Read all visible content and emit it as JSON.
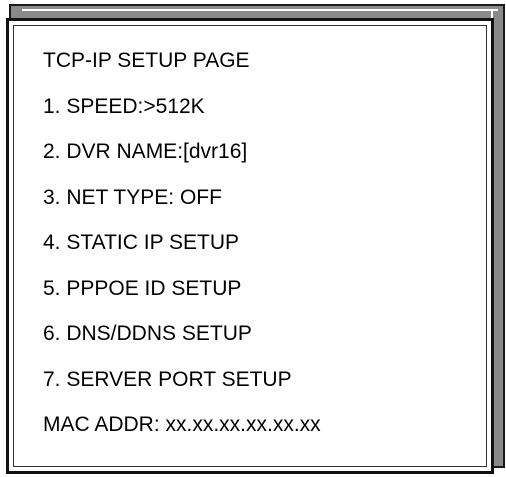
{
  "menu": {
    "title": "TCP-IP SETUP PAGE",
    "items": [
      {
        "label": "1. SPEED:>512K"
      },
      {
        "label": "2. DVR NAME:[dvr16]"
      },
      {
        "label": "3. NET TYPE: OFF"
      },
      {
        "label": "4. STATIC IP SETUP"
      },
      {
        "label": "5. PPPOE ID SETUP"
      },
      {
        "label": "6. DNS/DDNS SETUP"
      },
      {
        "label": "7. SERVER PORT SETUP"
      }
    ],
    "mac_address": "MAC ADDR: xx.xx.xx.xx.xx.xx"
  },
  "colors": {
    "background": "#ffffff",
    "text": "#000000",
    "frame": "#111111",
    "shadow": "#8a8a8a"
  }
}
